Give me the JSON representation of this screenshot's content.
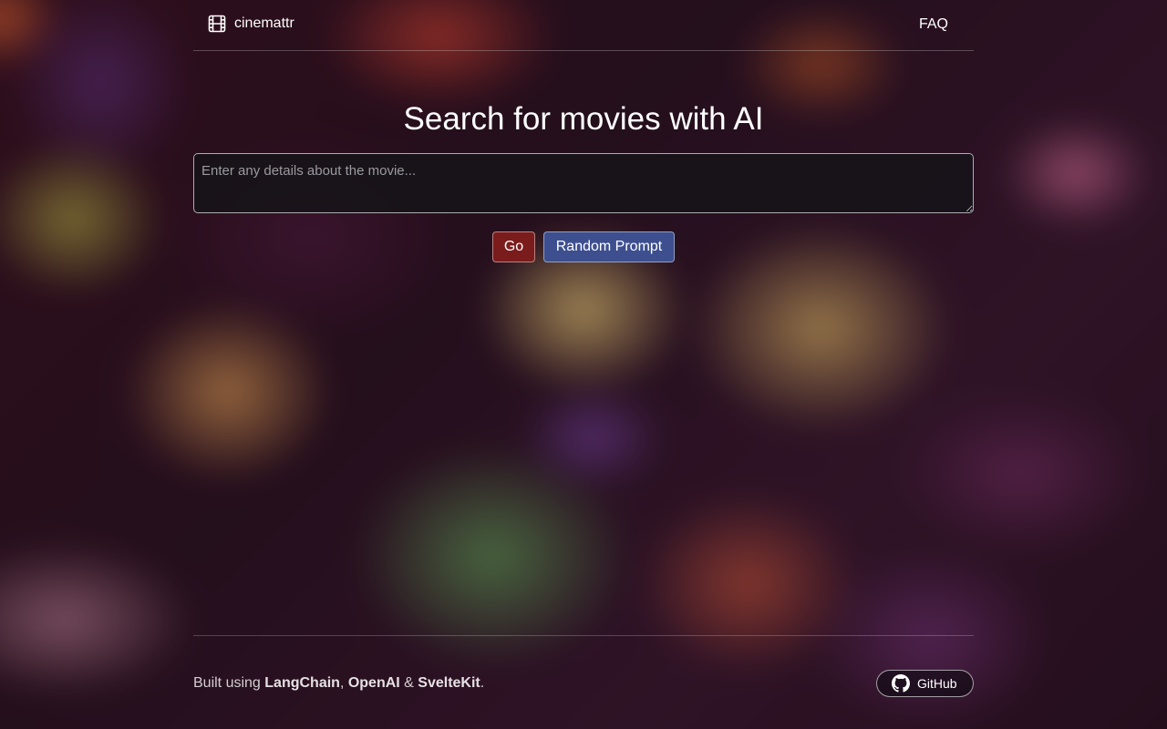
{
  "header": {
    "brand_name": "cinemattr",
    "brand_icon": "film-icon",
    "faq_label": "FAQ"
  },
  "main": {
    "title": "Search for movies with AI",
    "query_placeholder": "Enter any details about the movie...",
    "query_value": "",
    "go_label": "Go",
    "random_label": "Random Prompt"
  },
  "footer": {
    "prefix": "Built using ",
    "tech1": "LangChain",
    "sep1": ", ",
    "tech2": "OpenAI",
    "sep2": " & ",
    "tech3": "SvelteKit",
    "suffix": ".",
    "github_label": "GitHub",
    "github_icon": "github-icon"
  },
  "colors": {
    "go_button": "#7b1c1c",
    "random_button": "#3d4f8f",
    "text": "#ffffff"
  }
}
